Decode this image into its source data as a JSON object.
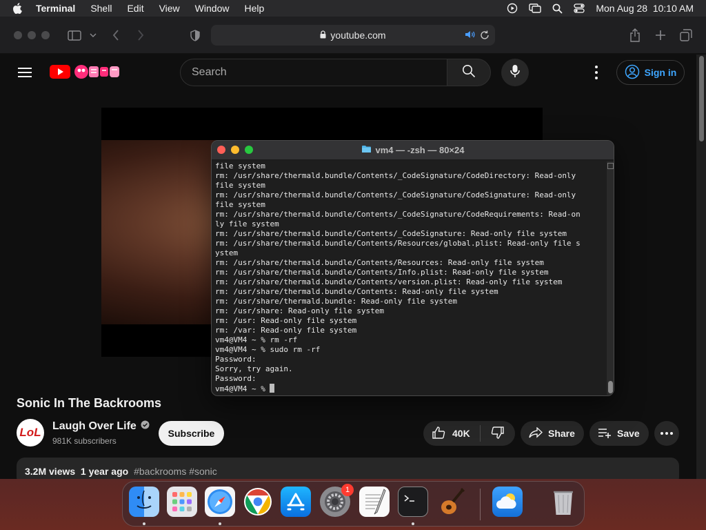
{
  "menubar": {
    "app_name": "Terminal",
    "items": [
      "Shell",
      "Edit",
      "View",
      "Window",
      "Help"
    ],
    "datetime": "Mon Aug 28  10:10 AM"
  },
  "safari": {
    "url": "youtube.com"
  },
  "youtube": {
    "search_placeholder": "Search",
    "sign_in": "Sign in",
    "video_title": "Sonic In The Backrooms",
    "channel_name": "Laugh Over Life",
    "channel_avatar_text": "LoL",
    "subscribers": "981K subscribers",
    "subscribe_label": "Subscribe",
    "likes": "40K",
    "share_label": "Share",
    "save_label": "Save",
    "views_age": "3.2M views  1 year ago",
    "hashtags": "#backrooms #sonic"
  },
  "terminal": {
    "title": "vm4 — -zsh — 80×24",
    "lines": [
      "file system",
      "rm: /usr/share/thermald.bundle/Contents/_CodeSignature/CodeDirectory: Read-only",
      "file system",
      "rm: /usr/share/thermald.bundle/Contents/_CodeSignature/CodeSignature: Read-only",
      "file system",
      "rm: /usr/share/thermald.bundle/Contents/_CodeSignature/CodeRequirements: Read-on",
      "ly file system",
      "rm: /usr/share/thermald.bundle/Contents/_CodeSignature: Read-only file system",
      "rm: /usr/share/thermald.bundle/Contents/Resources/global.plist: Read-only file s",
      "ystem",
      "rm: /usr/share/thermald.bundle/Contents/Resources: Read-only file system",
      "rm: /usr/share/thermald.bundle/Contents/Info.plist: Read-only file system",
      "rm: /usr/share/thermald.bundle/Contents/version.plist: Read-only file system",
      "rm: /usr/share/thermald.bundle/Contents: Read-only file system",
      "rm: /usr/share/thermald.bundle: Read-only file system",
      "rm: /usr/share: Read-only file system",
      "rm: /usr: Read-only file system",
      "rm: /var: Read-only file system",
      "vm4@VM4 ~ % rm -rf",
      "vm4@VM4 ~ % sudo rm -rf",
      "Password:",
      "Sorry, try again.",
      "Password:"
    ],
    "prompt": "vm4@VM4 ~ % "
  },
  "dock": {
    "apps": [
      "Finder",
      "Launchpad",
      "Safari",
      "Chrome",
      "App Store",
      "System Settings",
      "TextEdit",
      "Terminal",
      "GarageBand",
      "Weather",
      "Trash"
    ],
    "settings_badge": "1"
  },
  "colors": {
    "yt_red": "#ff0000",
    "link_blue": "#3ea6ff",
    "terminal_bg": "#1e1e1e"
  }
}
